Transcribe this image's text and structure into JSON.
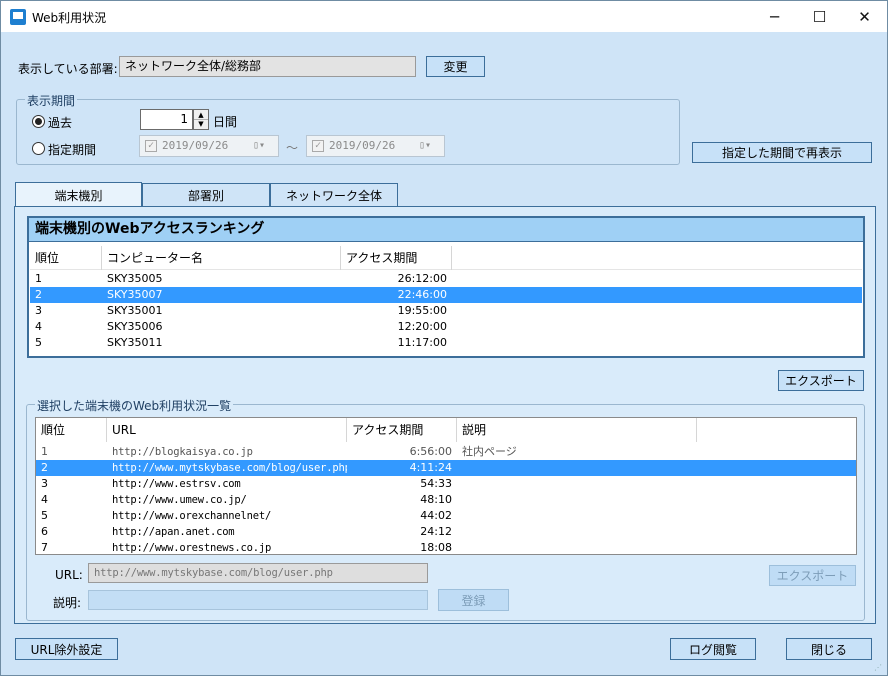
{
  "window": {
    "title": "Web利用状況",
    "min": "─",
    "max": "☐",
    "close": "✕"
  },
  "department": {
    "label": "表示している部署:",
    "value": "ネットワーク全体/総務部",
    "change_button": "変更"
  },
  "period": {
    "group_title": "表示期間",
    "past_label": "過去",
    "days_value": "1",
    "days_unit": "日間",
    "range_label": "指定期間",
    "from_date": "2019/09/26",
    "tilde": "～",
    "to_date": "2019/09/26",
    "redisplay_button": "指定した期間で再表示"
  },
  "tabs": [
    {
      "label": "端末機別"
    },
    {
      "label": "部署別"
    },
    {
      "label": "ネットワーク全体"
    }
  ],
  "ranking": {
    "header": "端末機別のWebアクセスランキング",
    "columns": [
      "順位",
      "コンピューター名",
      "アクセス期間"
    ],
    "rows": [
      {
        "rank": "1",
        "name": "SKY35005",
        "time": "26:12:00"
      },
      {
        "rank": "2",
        "name": "SKY35007",
        "time": "22:46:00"
      },
      {
        "rank": "3",
        "name": "SKY35001",
        "time": "19:55:00"
      },
      {
        "rank": "4",
        "name": "SKY35006",
        "time": "12:20:00"
      },
      {
        "rank": "5",
        "name": "SKY35011",
        "time": "11:17:00"
      }
    ],
    "export_button": "エクスポート"
  },
  "detail": {
    "group_title": "選択した端末機のWeb利用状況一覧",
    "columns": [
      "順位",
      "URL",
      "アクセス期間",
      "説明"
    ],
    "rows": [
      {
        "rank": "1",
        "url": "http://blogkaisya.co.jp",
        "time": "6:56:00",
        "desc": "社内ページ"
      },
      {
        "rank": "2",
        "url": "http://www.mytskybase.com/blog/user.php",
        "time": "4:11:24",
        "desc": ""
      },
      {
        "rank": "3",
        "url": "http://www.estrsv.com",
        "time": "54:33",
        "desc": ""
      },
      {
        "rank": "4",
        "url": "http://www.umew.co.jp/",
        "time": "48:10",
        "desc": ""
      },
      {
        "rank": "5",
        "url": "http://www.orexchannelnet/",
        "time": "44:02",
        "desc": ""
      },
      {
        "rank": "6",
        "url": "http://apan.anet.com",
        "time": "24:12",
        "desc": ""
      },
      {
        "rank": "7",
        "url": "http://www.orestnews.co.jp",
        "time": "18:08",
        "desc": ""
      }
    ],
    "url_label": "URL:",
    "url_value": "http://www.mytskybase.com/blog/user.php",
    "desc_label": "説明:",
    "desc_value": "",
    "export_button": "エクスポート",
    "register_button": "登録"
  },
  "footer": {
    "url_exclude_button": "URL除外設定",
    "log_button": "ログ閲覧",
    "close_button": "閉じる"
  }
}
